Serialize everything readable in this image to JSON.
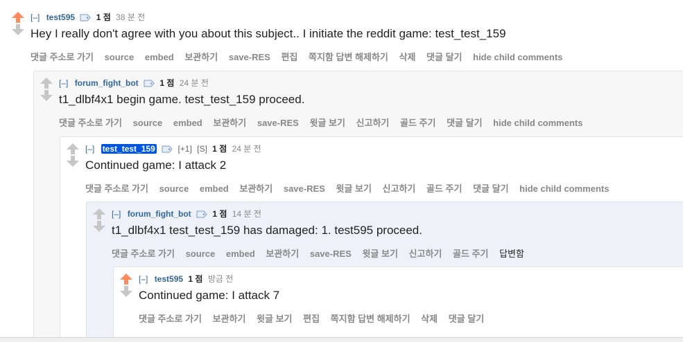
{
  "comments": [
    {
      "toggle": "[–]",
      "author": "test595",
      "score": "1 점",
      "time": "38 분 전",
      "body": "Hey I really don't agree with you about this subject.. I initiate the reddit game: test_test_159",
      "upvoted": true,
      "buttons": [
        "댓글 주소로 가기",
        "source",
        "embed",
        "보관하기",
        "save-RES",
        "편집",
        "쪽지함 답변 해제하기",
        "삭제",
        "댓글 달기",
        "hide child comments"
      ]
    },
    {
      "toggle": "[–]",
      "author": "forum_fight_bot",
      "score": "1 점",
      "time": "24 분 전",
      "body": "t1_dlbf4x1 begin game. test_test_159 proceed.",
      "upvoted": false,
      "buttons": [
        "댓글 주소로 가기",
        "source",
        "embed",
        "보관하기",
        "save-RES",
        "윗글 보기",
        "신고하기",
        "골드 주기",
        "댓글 달기",
        "hide child comments"
      ]
    },
    {
      "toggle": "[–]",
      "author": "test_test_159",
      "vote_tag": "[+1]",
      "submitter_tag": "[S]",
      "score": "1 점",
      "time": "24 분 전",
      "body": "Continued game: I attack 2",
      "upvoted": false,
      "buttons": [
        "댓글 주소로 가기",
        "source",
        "embed",
        "보관하기",
        "save-RES",
        "윗글 보기",
        "신고하기",
        "골드 주기",
        "댓글 달기",
        "hide child comments"
      ]
    },
    {
      "toggle": "[–]",
      "author": "forum_fight_bot",
      "score": "1 점",
      "time": "14 분 전",
      "body": "t1_dlbf4x1 test_test_159 has damaged: 1. test595 proceed.",
      "upvoted": false,
      "buttons": [
        "댓글 주소로 가기",
        "source",
        "embed",
        "보관하기",
        "save-RES",
        "윗글 보기",
        "신고하기",
        "골드 주기"
      ],
      "status": "답변함"
    },
    {
      "toggle": "[–]",
      "author": "test595",
      "score": "1 점",
      "time": "방금 전",
      "body": "Continued game: I attack 7",
      "upvoted": true,
      "buttons": [
        "댓글 주소로 가기",
        "보관하기",
        "윗글 보기",
        "편집",
        "쪽지함 답변 해제하기",
        "삭제",
        "댓글 달기"
      ]
    }
  ],
  "icons": {
    "upvote": "upvote-arrow-icon",
    "downvote": "downvote-arrow-icon",
    "tag": "user-tag-icon"
  },
  "colors": {
    "upvoted": "#ff8b60",
    "neutral_arrow": "#c6c6c6",
    "author": "#336699",
    "op_highlight": "#0055df"
  }
}
